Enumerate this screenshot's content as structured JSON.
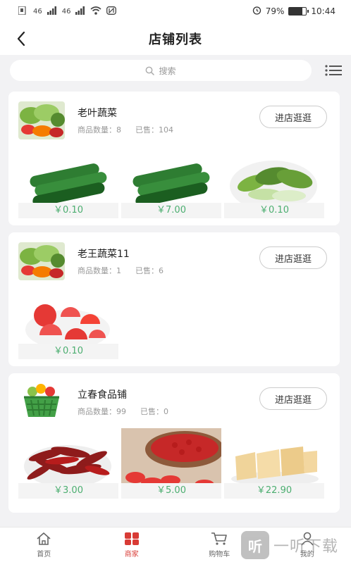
{
  "status_bar": {
    "left_signals": [
      "46",
      "46"
    ],
    "battery_percent": "79%",
    "battery_level": 0.79,
    "time": "10:44"
  },
  "nav": {
    "title": "店铺列表",
    "back_icon": "chevron-left-icon"
  },
  "search": {
    "placeholder": "搜索",
    "icon": "search-icon",
    "list_icon": "list-icon"
  },
  "shops": [
    {
      "name": "老叶蔬菜",
      "goods_label": "商品数量：",
      "goods_count": "8",
      "sold_label": "已售：",
      "sold_count": "104",
      "enter_label": "进店逛逛",
      "products": [
        {
          "image": "cucumber",
          "price": "￥0.10"
        },
        {
          "image": "cucumber",
          "price": "￥7.00"
        },
        {
          "image": "bok-choy",
          "price": "￥0.10"
        }
      ]
    },
    {
      "name": "老王蔬菜11",
      "goods_label": "商品数量：",
      "goods_count": "1",
      "sold_label": "已售：",
      "sold_count": "6",
      "enter_label": "进店逛逛",
      "products": [
        {
          "image": "tomato",
          "price": "￥0.10"
        }
      ]
    },
    {
      "name": "立春食品铺",
      "goods_label": "商品数量：",
      "goods_count": "99",
      "sold_label": "已售：",
      "sold_count": "0",
      "enter_label": "进店逛逛",
      "products": [
        {
          "image": "dried-chili",
          "price": "￥3.00"
        },
        {
          "image": "goji",
          "price": "￥5.00"
        },
        {
          "image": "tofu-skin",
          "price": "￥22.90"
        }
      ]
    }
  ],
  "tabbar": [
    {
      "label": "首页",
      "icon": "home-icon",
      "active": false
    },
    {
      "label": "商家",
      "icon": "store-icon",
      "active": true
    },
    {
      "label": "购物车",
      "icon": "cart-icon",
      "active": false
    },
    {
      "label": "我的",
      "icon": "user-icon",
      "active": false
    }
  ],
  "watermark": {
    "logo": "听",
    "text": "一听下载"
  },
  "colors": {
    "accent": "#d83b35",
    "price": "#4cae70"
  }
}
